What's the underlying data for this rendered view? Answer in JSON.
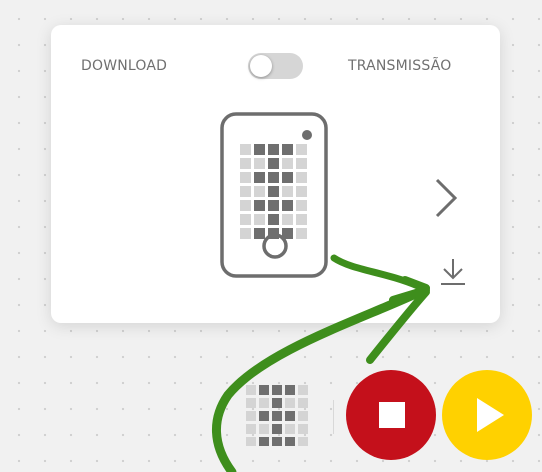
{
  "panel": {
    "download_label": "DOWNLOAD",
    "stream_label": "TRANSMISSÃO",
    "toggle_state": "download"
  },
  "icons": {
    "device": "microbit-device-icon",
    "next": "chevron-right-icon",
    "download": "download-icon",
    "grid": "led-grid-icon",
    "stop": "stop-icon",
    "play": "play-icon",
    "annotation": "annotation-arrow"
  },
  "colors": {
    "stop_button": "#C4101B",
    "play_button": "#FFD100",
    "annotation_arrow": "#3E8E1C",
    "device_outline": "#6d6d6d"
  }
}
